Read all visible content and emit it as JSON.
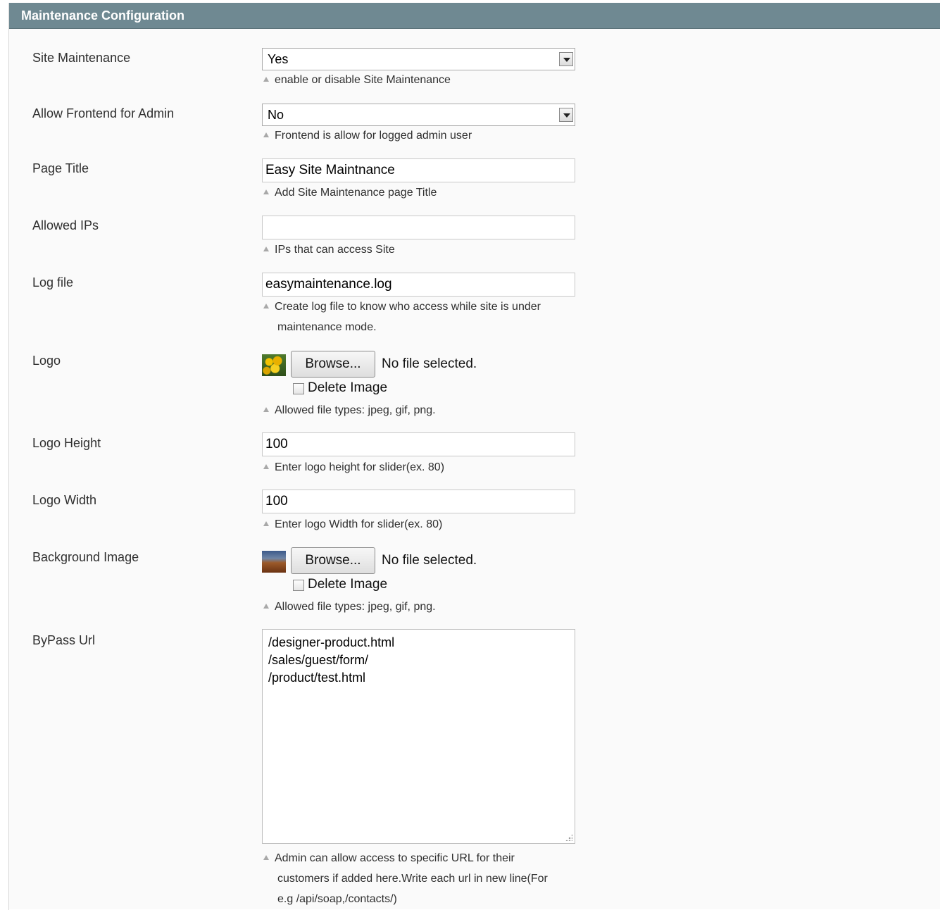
{
  "section": {
    "title": "Maintenance Configuration"
  },
  "fields": {
    "site_maintenance": {
      "label": "Site Maintenance",
      "value": "Yes",
      "note": "enable or disable Site Maintenance"
    },
    "allow_frontend": {
      "label": "Allow Frontend for Admin",
      "value": "No",
      "note": "Frontend is allow for logged admin user"
    },
    "page_title": {
      "label": "Page Title",
      "value": "Easy Site Maintnance",
      "note": "Add Site Maintenance page Title"
    },
    "allowed_ips": {
      "label": "Allowed IPs",
      "value": "",
      "note": "IPs that can access Site"
    },
    "log_file": {
      "label": "Log file",
      "value": "easymaintenance.log",
      "note_line1": "Create log file to know who access while site is under",
      "note_line2": "maintenance mode."
    },
    "logo": {
      "label": "Logo",
      "browse_label": "Browse...",
      "file_status": "No file selected.",
      "delete_label": "Delete Image",
      "note": "Allowed file types: jpeg, gif, png."
    },
    "logo_height": {
      "label": "Logo Height",
      "value": "100",
      "note": "Enter logo height for slider(ex. 80)"
    },
    "logo_width": {
      "label": "Logo Width",
      "value": "100",
      "note": "Enter logo Width for slider(ex. 80)"
    },
    "background_image": {
      "label": "Background Image",
      "browse_label": "Browse...",
      "file_status": "No file selected.",
      "delete_label": "Delete Image",
      "note": "Allowed file types: jpeg, gif, png."
    },
    "bypass_url": {
      "label": "ByPass Url",
      "lines": [
        "/designer-product.html",
        "/sales/guest/form/",
        "/product/test.html"
      ],
      "note_line1": "Admin can allow access to specific URL for their",
      "note_line2": "customers if added here.Write each url in new line(For",
      "note_line3": "e.g /api/soap,/contacts/)"
    }
  },
  "colors": {
    "header_bg": "#6f8992",
    "header_text": "#ffffff",
    "body_bg": "#fafafa",
    "note_arrow": "#a8a8a8"
  },
  "icons": {
    "select_arrow": "chevron-down-icon",
    "note_marker": "triangle-up-icon",
    "logo_thumbnail": "flower-thumbnail",
    "background_thumbnail": "landscape-thumbnail"
  }
}
